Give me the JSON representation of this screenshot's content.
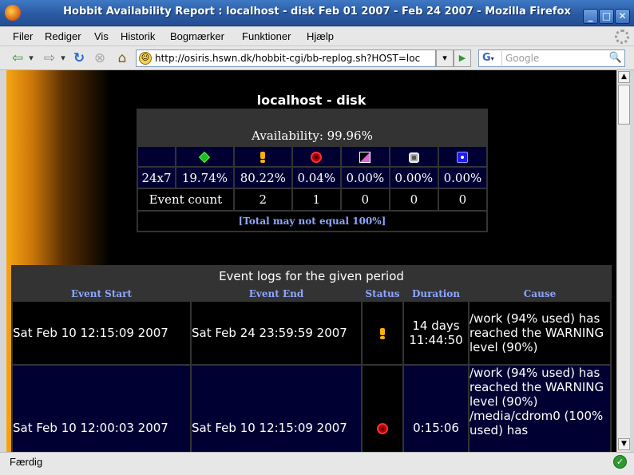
{
  "window": {
    "title": "Hobbit Availability Report : localhost - disk Feb 01 2007 - Feb 24 2007 - Mozilla Firefox",
    "minimize": "_",
    "maximize": "□",
    "close": "✕"
  },
  "menu": {
    "items": [
      "Filer",
      "Rediger",
      "Vis",
      "Historik",
      "Bogmærker",
      "Funktioner",
      "Hjælp"
    ]
  },
  "nav": {
    "back": "⇦",
    "forward": "⇨",
    "reload": "↻",
    "stop": "⊗",
    "home": "⌂",
    "url": "http://osiris.hswn.dk/hobbit-cgi/bb-replog.sh?HOST=loc",
    "go": "▶",
    "search_engine": "G",
    "search_placeholder": "Google",
    "search_button": "🔍",
    "dropdown": "▾"
  },
  "report": {
    "title": "localhost - disk",
    "availability": "Availability: 99.96%",
    "period_label": "24x7",
    "percentages": [
      "19.74%",
      "80.22%",
      "0.04%",
      "0.00%",
      "0.00%",
      "0.00%"
    ],
    "event_count_label": "Event count",
    "event_counts": [
      "2",
      "1",
      "0",
      "0",
      "0"
    ],
    "note": "[Total may not equal 100%]",
    "status_icons": [
      "green-icon",
      "yellow-icon",
      "red-icon",
      "purple-icon",
      "clear-icon",
      "blue-icon"
    ]
  },
  "events": {
    "title": "Event logs for the given period",
    "headers": [
      "Event Start",
      "Event End",
      "Status",
      "Duration",
      "Cause"
    ],
    "rows": [
      {
        "start": "Sat Feb 10 12:15:09 2007",
        "end": "Sat Feb 24 23:59:59 2007",
        "status": "yellow",
        "duration": "14 days 11:44:50",
        "cause": "/work (94% used) has reached the WARNING level (90%)"
      },
      {
        "start": "Sat Feb 10 12:00:03 2007",
        "end": "Sat Feb 10 12:15:09 2007",
        "status": "red",
        "duration": "0:15:06",
        "cause": "/work (94% used) has reached the WARNING level (90%) /media/cdrom0 (100% used) has"
      }
    ]
  },
  "status_bar": {
    "text": "Færdig"
  },
  "colors": {
    "titlebar": "#2a5aa3",
    "page_background": "#000000",
    "table_background": "#333333",
    "row_navy": "#000033",
    "link_blue": "#8ea6ff"
  }
}
